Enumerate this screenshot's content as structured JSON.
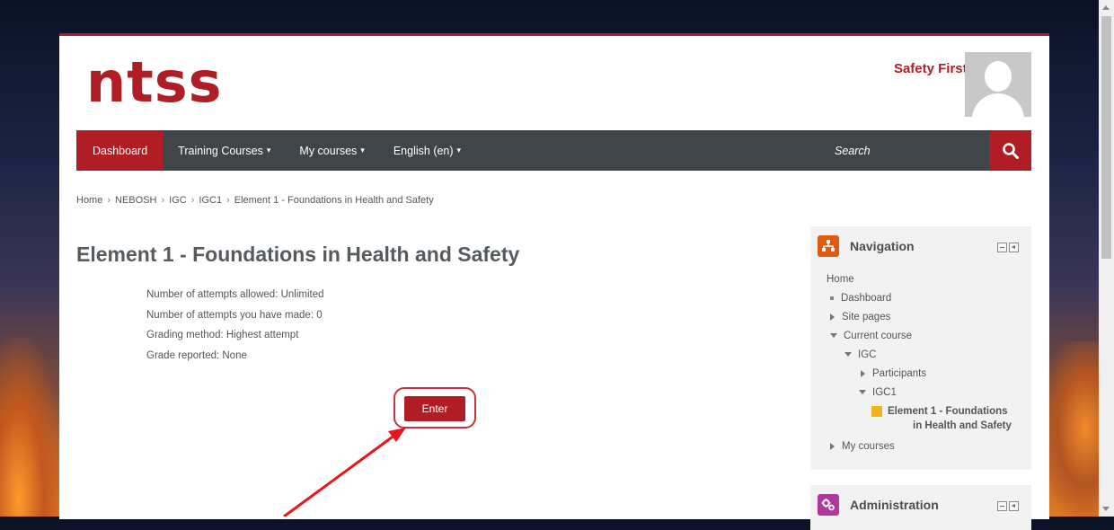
{
  "site": {
    "logo": "ntss",
    "user_name": "Safety First",
    "user_caret": "ˇ"
  },
  "navbar": {
    "items": [
      {
        "label": "Dashboard",
        "active": true,
        "caret": ""
      },
      {
        "label": "Training Courses",
        "active": false,
        "caret": "▾"
      },
      {
        "label": "My courses",
        "active": false,
        "caret": "▾"
      },
      {
        "label": "English (en)",
        "active": false,
        "caret": "▾"
      }
    ],
    "search_label": "Search"
  },
  "breadcrumb": [
    "Home",
    "NEBOSH",
    "IGC",
    "IGC1",
    "Element 1 - Foundations in Health and Safety"
  ],
  "breadcrumb_separator": "›",
  "main": {
    "title": "Element 1 - Foundations in Health and Safety",
    "info": [
      "Number of attempts allowed: Unlimited",
      "Number of attempts you have made: 0",
      "Grading method: Highest attempt",
      "Grade reported: None"
    ],
    "enter_label": "Enter"
  },
  "navigation_block": {
    "title": "Navigation",
    "home": "Home",
    "dashboard": "Dashboard",
    "site_pages": "Site pages",
    "current_course": "Current course",
    "igc": "IGC",
    "participants": "Participants",
    "igc1": "IGC1",
    "current_item_line1": "Element 1 - Foundations",
    "current_item_line2": "in Health and Safety",
    "my_courses": "My courses"
  },
  "administration_block": {
    "title": "Administration"
  },
  "colors": {
    "brand_red": "#b01d24",
    "navbar_dark": "#3f4549",
    "nav_icon_orange": "#e05a12",
    "admin_icon_magenta": "#b0389c",
    "annotation_red": "#e8151b"
  }
}
